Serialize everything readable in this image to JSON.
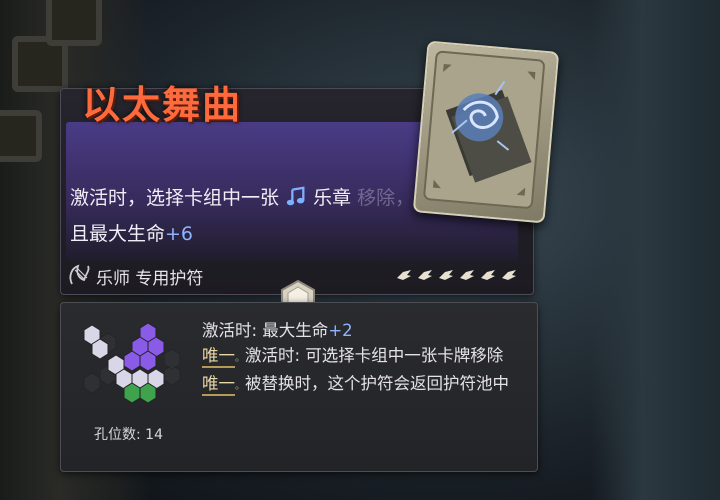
{
  "card": {
    "title": "以太舞曲",
    "description": {
      "part1": "激活时，选择卡组中一张",
      "keyword": "乐章",
      "part2_faded": "移除，",
      "part3": "且最大生命",
      "bonus": "+6"
    },
    "class_label": "乐师 专用护符",
    "rarity_count": 6,
    "colors": {
      "title": "#ff6a3d",
      "highlight": "#8fb4ff",
      "unique": "#e8d7a6"
    },
    "icons": {
      "keyword": "music-note-icon",
      "class": "lyre-icon",
      "rarity": "wing-icon",
      "socket": "hex-socket-icon"
    }
  },
  "talisman": {
    "hole_count_label": "孔位数: 14",
    "effects": {
      "line1_text": "激活时: 最大生命",
      "line1_bonus": "+2",
      "unique_tag": "唯一",
      "line2_text": "激活时: 可选择卡组中一张卡牌移除",
      "line3_text": "被替换时，这个护符会返回护符池中"
    }
  }
}
